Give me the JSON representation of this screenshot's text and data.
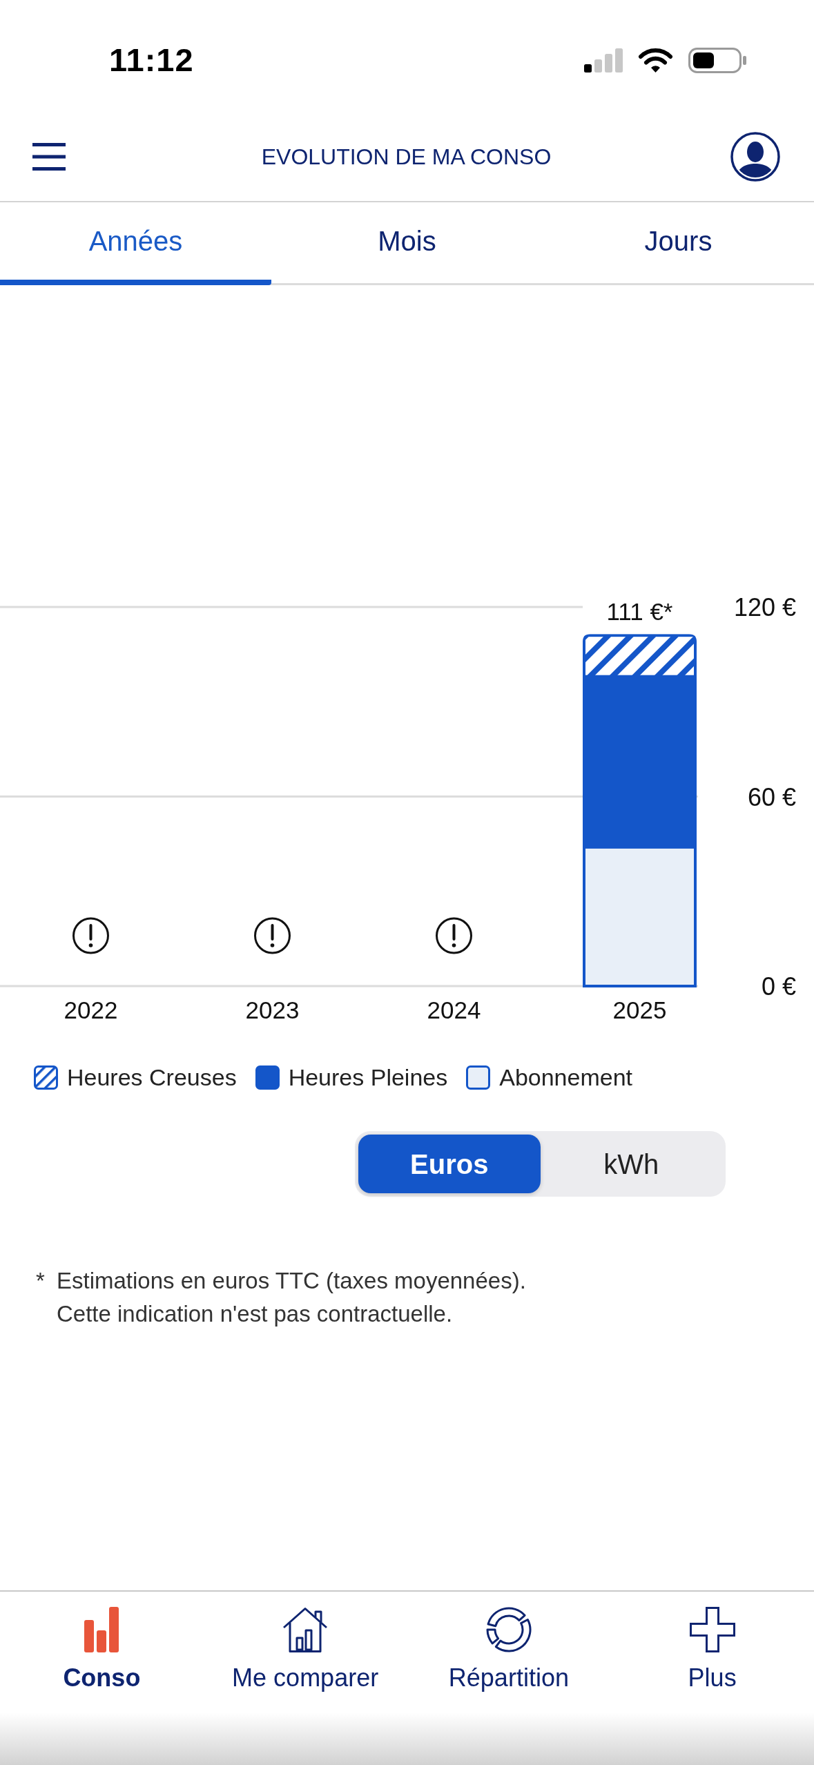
{
  "status_bar": {
    "time": "11:12"
  },
  "header": {
    "title": "EVOLUTION DE MA CONSO"
  },
  "tabs": [
    {
      "label": "Années",
      "selected": true
    },
    {
      "label": "Mois",
      "selected": false
    },
    {
      "label": "Jours",
      "selected": false
    }
  ],
  "chart": {
    "chart_data": {
      "type": "bar",
      "stacked": true,
      "categories": [
        "2022",
        "2023",
        "2024",
        "2025"
      ],
      "series": [
        {
          "name": "Abonnement",
          "color": "#e8eff8",
          "values": [
            null,
            null,
            null,
            44
          ]
        },
        {
          "name": "Heures Pleines",
          "color": "#1456c9",
          "values": [
            null,
            null,
            null,
            54
          ]
        },
        {
          "name": "Heures Creuses",
          "color": "#1456c9",
          "values": [
            null,
            null,
            null,
            13
          ]
        }
      ],
      "ylim": [
        0,
        120
      ],
      "yticks": [
        {
          "value": 0,
          "label": "0 €"
        },
        {
          "value": 60,
          "label": "60 €"
        },
        {
          "value": 120,
          "label": "120 €"
        }
      ],
      "value_labels": [
        null,
        null,
        null,
        "111 €*"
      ]
    },
    "series_fill": [
      {
        "kind": "solid"
      },
      {
        "kind": "solid"
      },
      {
        "kind": "hatched"
      }
    ]
  },
  "unit_toggle": [
    {
      "label": "Euros",
      "selected": true
    },
    {
      "label": "kWh",
      "selected": false
    }
  ],
  "footnote": {
    "marker": "*",
    "text": "Estimations en euros TTC (taxes moyennées).\nCette indication n'est pas contractuelle."
  },
  "bottom_nav": [
    {
      "label": "Conso",
      "selected": true
    },
    {
      "label": "Me comparer",
      "selected": false
    },
    {
      "label": "Répartition",
      "selected": false
    },
    {
      "label": "Plus",
      "selected": false
    }
  ]
}
